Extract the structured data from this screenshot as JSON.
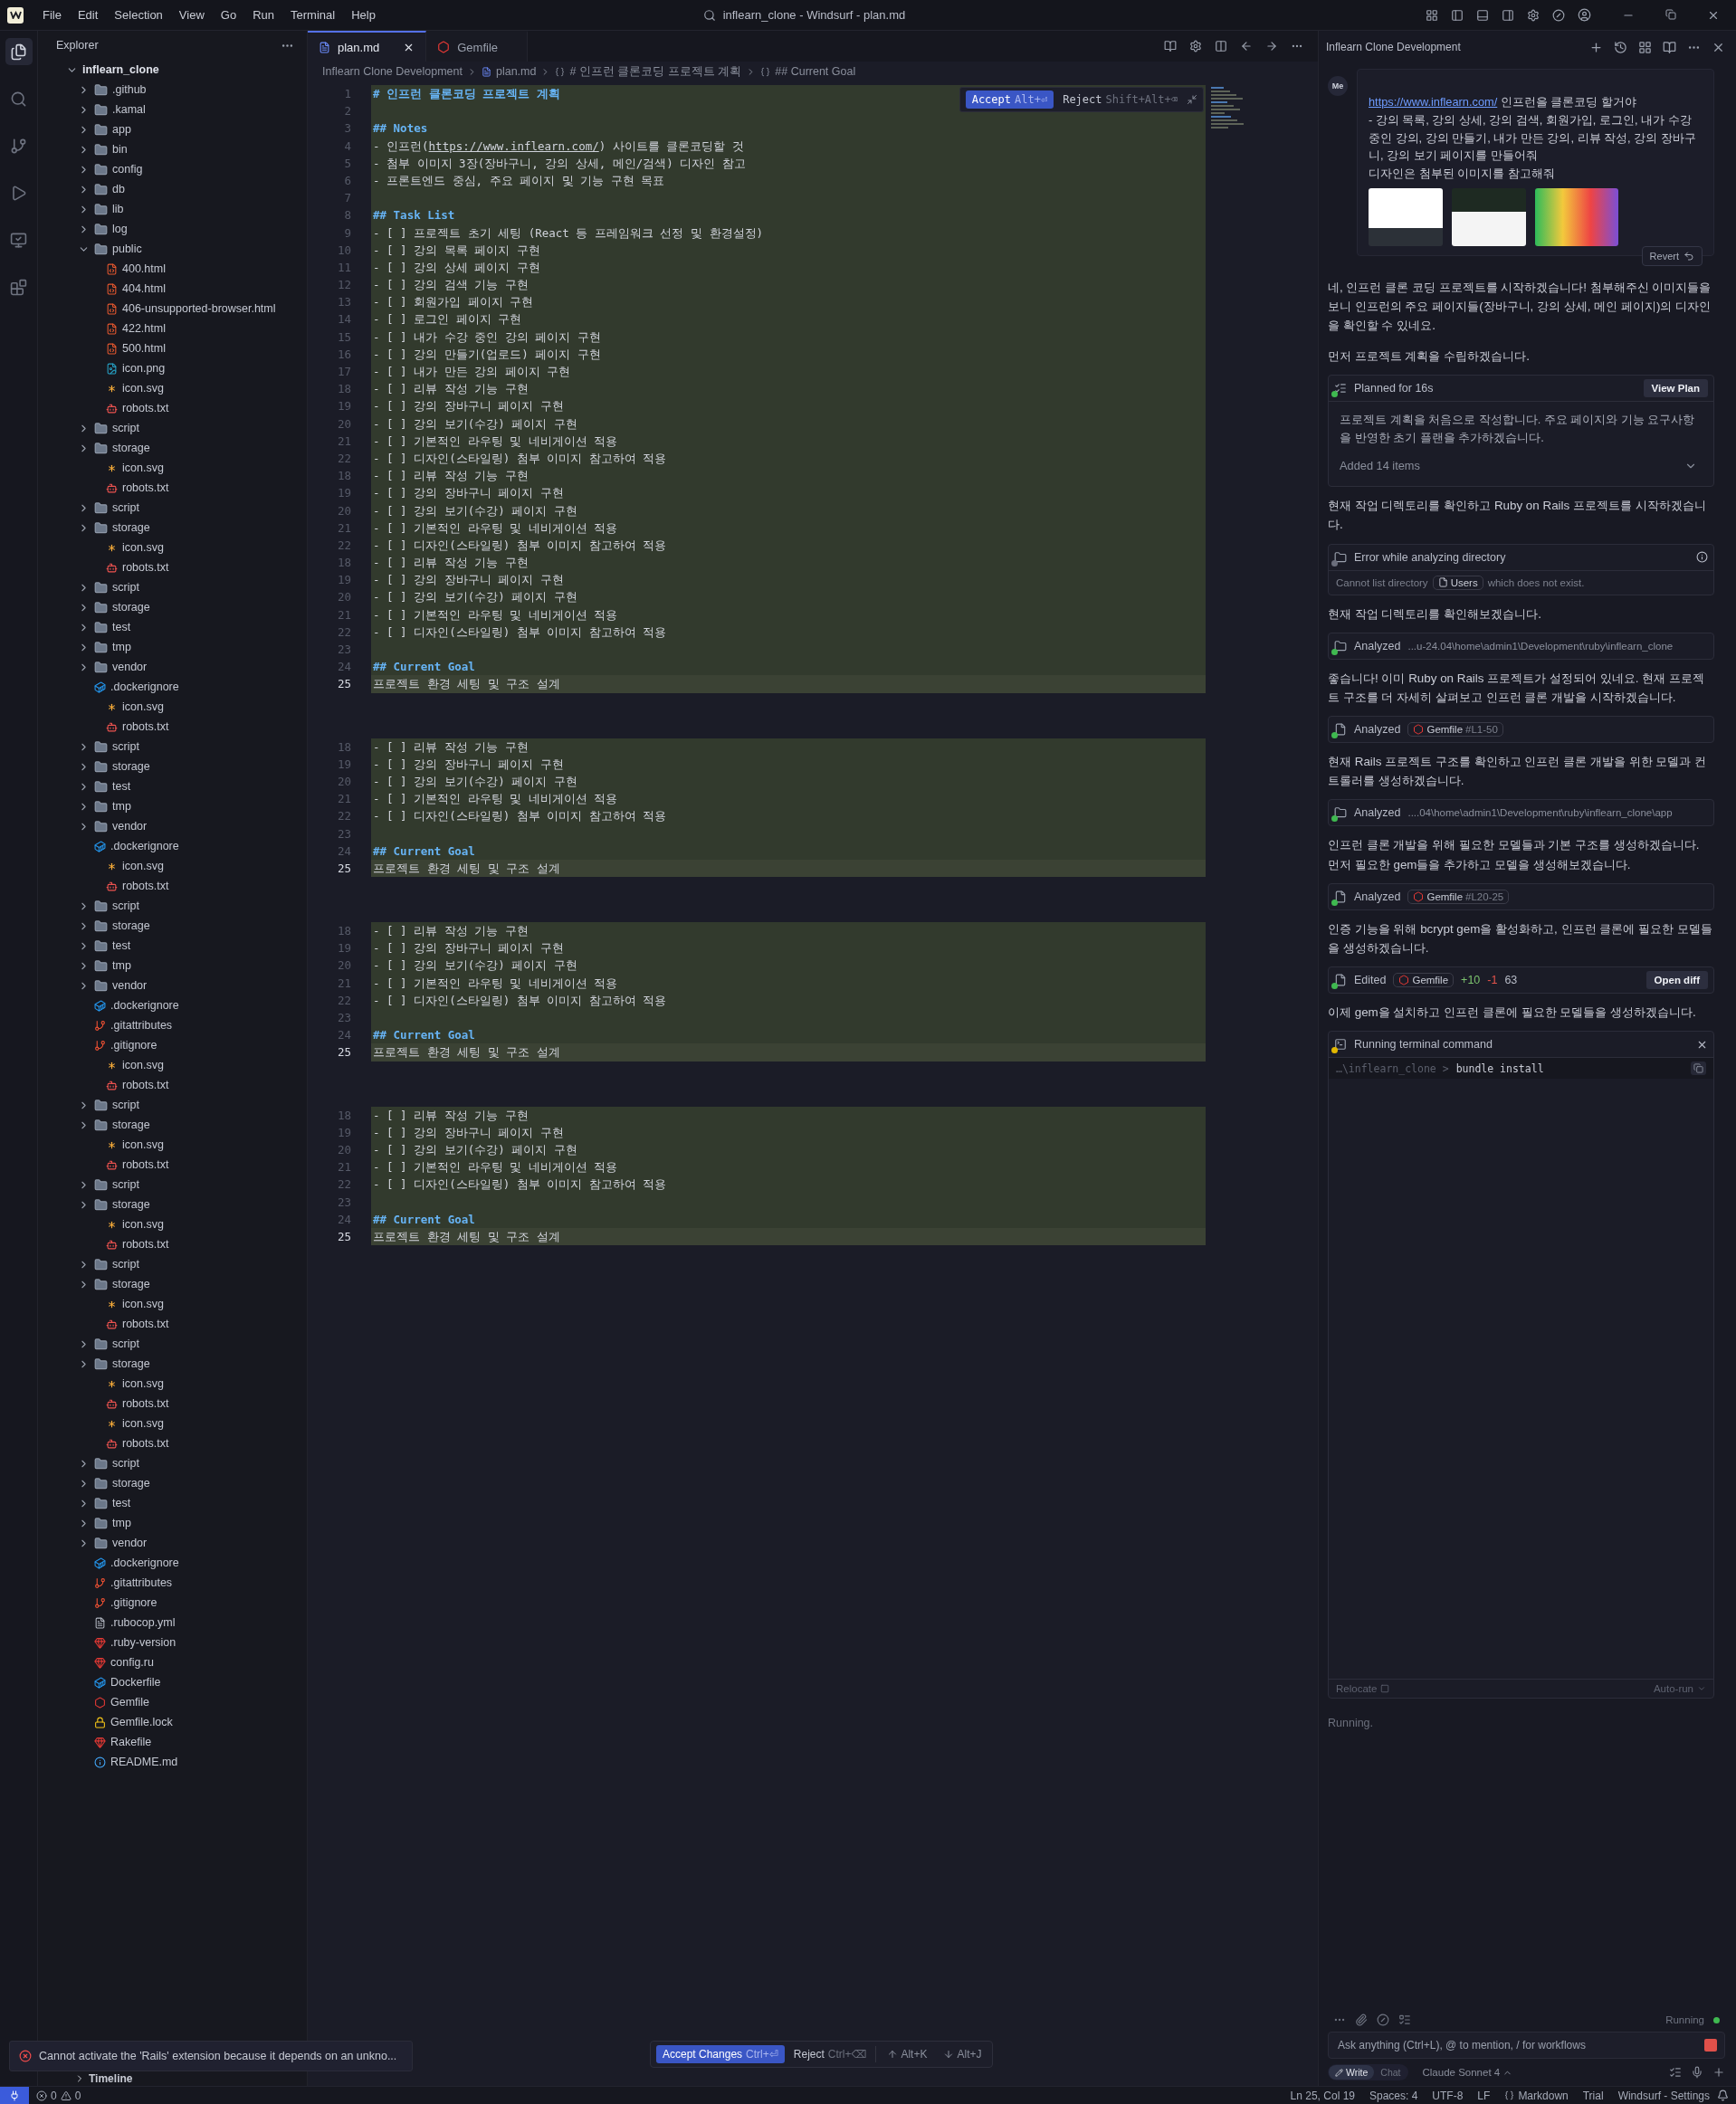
{
  "titlebar": {
    "menu": [
      "File",
      "Edit",
      "Selection",
      "View",
      "Go",
      "Run",
      "Terminal",
      "Help"
    ],
    "title": "inflearn_clone - Windsurf - plan.md"
  },
  "explorer": {
    "title": "Explorer",
    "timeline": "Timeline",
    "tree": {
      "name": "inflearn_clone",
      "kind": "folder",
      "expanded": true,
      "children": [
        {
          "name": ".github",
          "kind": "folder",
          "expanded": false
        },
        {
          "name": ".kamal",
          "kind": "folder",
          "expanded": false
        },
        {
          "name": "app",
          "kind": "folder",
          "expanded": false
        },
        {
          "name": "bin",
          "kind": "folder",
          "expanded": false
        },
        {
          "name": "config",
          "kind": "folder",
          "expanded": false
        },
        {
          "name": "db",
          "kind": "folder",
          "expanded": false
        },
        {
          "name": "lib",
          "kind": "folder",
          "expanded": false
        },
        {
          "name": "log",
          "kind": "folder",
          "expanded": false
        },
        {
          "name": "public",
          "kind": "folder",
          "expanded": true,
          "children": [
            {
              "name": "400.html",
              "kind": "html"
            },
            {
              "name": "404.html",
              "kind": "html"
            },
            {
              "name": "406-unsupported-browser.html",
              "kind": "html"
            },
            {
              "name": "422.html",
              "kind": "html"
            },
            {
              "name": "500.html",
              "kind": "html"
            },
            {
              "name": "icon.png",
              "kind": "image"
            },
            {
              "name": "icon.svg",
              "kind": "svg"
            },
            {
              "name": "robots.txt",
              "kind": "robots"
            }
          ]
        },
        {
          "name": "script",
          "kind": "folder",
          "expanded": false
        },
        {
          "name": "storage",
          "kind": "folder",
          "expanded": false,
          "children": [
            {
              "name": "icon.svg",
              "kind": "svg"
            },
            {
              "name": "robots.txt",
              "kind": "robots"
            }
          ]
        },
        {
          "name": "script",
          "kind": "folder",
          "expanded": false
        },
        {
          "name": "storage",
          "kind": "folder",
          "expanded": false,
          "children": [
            {
              "name": "icon.svg",
              "kind": "svg"
            },
            {
              "name": "robots.txt",
              "kind": "robots"
            }
          ]
        },
        {
          "name": "script",
          "kind": "folder",
          "expanded": false
        },
        {
          "name": "storage",
          "kind": "folder",
          "expanded": false
        },
        {
          "name": "test",
          "kind": "folder",
          "expanded": false
        },
        {
          "name": "tmp",
          "kind": "folder",
          "expanded": false
        },
        {
          "name": "vendor",
          "kind": "folder",
          "expanded": false
        },
        {
          "name": ".dockerignore",
          "kind": "docker",
          "children": [
            {
              "name": "icon.svg",
              "kind": "svg"
            },
            {
              "name": "robots.txt",
              "kind": "robots"
            }
          ]
        },
        {
          "name": "script",
          "kind": "folder",
          "expanded": false
        },
        {
          "name": "storage",
          "kind": "folder",
          "expanded": false
        },
        {
          "name": "test",
          "kind": "folder",
          "expanded": false
        },
        {
          "name": "tmp",
          "kind": "folder",
          "expanded": false
        },
        {
          "name": "vendor",
          "kind": "folder",
          "expanded": false
        },
        {
          "name": ".dockerignore",
          "kind": "docker",
          "children": [
            {
              "name": "icon.svg",
              "kind": "svg"
            },
            {
              "name": "robots.txt",
              "kind": "robots"
            }
          ]
        },
        {
          "name": "script",
          "kind": "folder",
          "expanded": false
        },
        {
          "name": "storage",
          "kind": "folder",
          "expanded": false
        },
        {
          "name": "test",
          "kind": "folder",
          "expanded": false
        },
        {
          "name": "tmp",
          "kind": "folder",
          "expanded": false
        },
        {
          "name": "vendor",
          "kind": "folder",
          "expanded": false
        },
        {
          "name": ".dockerignore",
          "kind": "docker"
        },
        {
          "name": ".gitattributes",
          "kind": "git"
        },
        {
          "name": ".gitignore",
          "kind": "git",
          "children": [
            {
              "name": "icon.svg",
              "kind": "svg"
            },
            {
              "name": "robots.txt",
              "kind": "robots"
            }
          ]
        },
        {
          "name": "script",
          "kind": "folder",
          "expanded": false
        },
        {
          "name": "storage",
          "kind": "folder",
          "expanded": false,
          "children": [
            {
              "name": "icon.svg",
              "kind": "svg"
            },
            {
              "name": "robots.txt",
              "kind": "robots"
            }
          ]
        },
        {
          "name": "script",
          "kind": "folder",
          "expanded": false
        },
        {
          "name": "storage",
          "kind": "folder",
          "expanded": false,
          "children": [
            {
              "name": "icon.svg",
              "kind": "svg"
            },
            {
              "name": "robots.txt",
              "kind": "robots"
            }
          ]
        },
        {
          "name": "script",
          "kind": "folder",
          "expanded": false
        },
        {
          "name": "storage",
          "kind": "folder",
          "expanded": false,
          "children": [
            {
              "name": "icon.svg",
              "kind": "svg"
            },
            {
              "name": "robots.txt",
              "kind": "robots"
            }
          ]
        },
        {
          "name": "script",
          "kind": "folder",
          "expanded": false
        },
        {
          "name": "storage",
          "kind": "folder",
          "expanded": false,
          "children": [
            {
              "name": "icon.svg",
              "kind": "svg"
            },
            {
              "name": "robots.txt",
              "kind": "robots"
            },
            {
              "name": "icon.svg",
              "kind": "svg"
            },
            {
              "name": "robots.txt",
              "kind": "robots"
            }
          ]
        },
        {
          "name": "script",
          "kind": "folder",
          "expanded": false
        },
        {
          "name": "storage",
          "kind": "folder",
          "expanded": false
        },
        {
          "name": "test",
          "kind": "folder",
          "expanded": false
        },
        {
          "name": "tmp",
          "kind": "folder",
          "expanded": false
        },
        {
          "name": "vendor",
          "kind": "folder",
          "expanded": false
        },
        {
          "name": ".dockerignore",
          "kind": "docker"
        },
        {
          "name": ".gitattributes",
          "kind": "git"
        },
        {
          "name": ".gitignore",
          "kind": "git"
        },
        {
          "name": ".rubocop.yml",
          "kind": "yaml"
        },
        {
          "name": ".ruby-version",
          "kind": "ruby"
        },
        {
          "name": "config.ru",
          "kind": "ruby"
        },
        {
          "name": "Dockerfile",
          "kind": "docker"
        },
        {
          "name": "Gemfile",
          "kind": "gem"
        },
        {
          "name": "Gemfile.lock",
          "kind": "lock"
        },
        {
          "name": "Rakefile",
          "kind": "ruby"
        },
        {
          "name": "README.md",
          "kind": "info"
        }
      ]
    }
  },
  "tabs": [
    {
      "label": "plan.md",
      "kind": "markdown",
      "selected": true
    },
    {
      "label": "Gemfile",
      "kind": "gem",
      "selected": false
    }
  ],
  "breadcrumb": [
    "Inflearn Clone Development",
    "plan.md",
    "# 인프런 클론코딩 프로젝트 계획",
    "## Current Goal"
  ],
  "diff_toolbar": {
    "accept": "Accept",
    "accept_key": "Alt+⏎",
    "reject": "Reject",
    "reject_key": "Shift+Alt+⌫"
  },
  "editor": {
    "blocks": [
      {
        "lines": [
          {
            "number": "1",
            "kind": "h1",
            "text": "# 인프런 클론코딩 프로젝트 계획",
            "current": false
          },
          {
            "number": "2",
            "kind": "blank",
            "current": false
          },
          {
            "number": "3",
            "kind": "h2",
            "text": "## Notes",
            "current": false
          },
          {
            "number": "4",
            "kind": "link",
            "before": "- 인프런(",
            "link": "https://www.inflearn.com/",
            "after": ") 사이트를 클론코딩할 것",
            "current": false
          },
          {
            "number": "5",
            "kind": "text",
            "text": "- 첨부 이미지 3장(장바구니, 강의 상세, 메인/검색) 디자인 참고",
            "current": false
          },
          {
            "number": "6",
            "kind": "text",
            "text": "- 프론트엔드 중심, 주요 페이지 및 기능 구현 목표",
            "current": false
          },
          {
            "number": "7",
            "kind": "blank",
            "current": false
          },
          {
            "number": "8",
            "kind": "h2",
            "text": "## Task List",
            "current": false
          },
          {
            "number": "9",
            "kind": "text",
            "text": "- [ ] 프로젝트 초기 세팅 (React 등 프레임워크 선정 및 환경설정)",
            "current": false
          },
          {
            "number": "10",
            "kind": "text",
            "text": "- [ ] 강의 목록 페이지 구현",
            "current": false
          },
          {
            "number": "11",
            "kind": "text",
            "text": "- [ ] 강의 상세 페이지 구현",
            "current": false
          },
          {
            "number": "12",
            "kind": "text",
            "text": "- [ ] 강의 검색 기능 구현",
            "current": false
          },
          {
            "number": "13",
            "kind": "text",
            "text": "- [ ] 회원가입 페이지 구현",
            "current": false
          },
          {
            "number": "14",
            "kind": "text",
            "text": "- [ ] 로그인 페이지 구현",
            "current": false
          },
          {
            "number": "15",
            "kind": "text",
            "text": "- [ ] 내가 수강 중인 강의 페이지 구현",
            "current": false
          },
          {
            "number": "16",
            "kind": "text",
            "text": "- [ ] 강의 만들기(업로드) 페이지 구현",
            "current": false
          },
          {
            "number": "17",
            "kind": "text",
            "text": "- [ ] 내가 만든 강의 페이지 구현",
            "current": false
          },
          {
            "number": "18",
            "kind": "text",
            "text": "- [ ] 리뷰 작성 기능 구현",
            "current": false
          },
          {
            "number": "19",
            "kind": "text",
            "text": "- [ ] 강의 장바구니 페이지 구현",
            "current": false
          },
          {
            "number": "20",
            "kind": "text",
            "text": "- [ ] 강의 보기(수강) 페이지 구현",
            "current": false
          },
          {
            "number": "21",
            "kind": "text",
            "text": "- [ ] 기본적인 라우팅 및 네비게이션 적용",
            "current": false
          },
          {
            "number": "22",
            "kind": "text",
            "text": "- [ ] 디자인(스타일링) 첨부 이미지 참고하여 적용",
            "current": false
          },
          {
            "number": "18",
            "kind": "text",
            "text": "- [ ] 리뷰 작성 기능 구현",
            "current": false
          },
          {
            "number": "19",
            "kind": "text",
            "text": "- [ ] 강의 장바구니 페이지 구현",
            "current": false
          },
          {
            "number": "20",
            "kind": "text",
            "text": "- [ ] 강의 보기(수강) 페이지 구현",
            "current": false
          },
          {
            "number": "21",
            "kind": "text",
            "text": "- [ ] 기본적인 라우팅 및 네비게이션 적용",
            "current": false
          },
          {
            "number": "22",
            "kind": "text",
            "text": "- [ ] 디자인(스타일링) 첨부 이미지 참고하여 적용",
            "current": false
          },
          {
            "number": "18",
            "kind": "text",
            "text": "- [ ] 리뷰 작성 기능 구현",
            "current": false
          },
          {
            "number": "19",
            "kind": "text",
            "text": "- [ ] 강의 장바구니 페이지 구현",
            "current": false
          },
          {
            "number": "20",
            "kind": "text",
            "text": "- [ ] 강의 보기(수강) 페이지 구현",
            "current": false
          },
          {
            "number": "21",
            "kind": "text",
            "text": "- [ ] 기본적인 라우팅 및 네비게이션 적용",
            "current": false
          },
          {
            "number": "22",
            "kind": "text",
            "text": "- [ ] 디자인(스타일링) 첨부 이미지 참고하여 적용",
            "current": false
          },
          {
            "number": "23",
            "kind": "blank",
            "current": false
          },
          {
            "number": "24",
            "kind": "h2",
            "text": "## Current Goal",
            "current": false
          },
          {
            "number": "25",
            "kind": "text",
            "text": "프로젝트 환경 세팅 및 구조 설계",
            "current": true
          }
        ]
      },
      {
        "lines": [
          {
            "number": "18",
            "kind": "text",
            "text": "- [ ] 리뷰 작성 기능 구현",
            "current": false
          },
          {
            "number": "19",
            "kind": "text",
            "text": "- [ ] 강의 장바구니 페이지 구현",
            "current": false
          },
          {
            "number": "20",
            "kind": "text",
            "text": "- [ ] 강의 보기(수강) 페이지 구현",
            "current": false
          },
          {
            "number": "21",
            "kind": "text",
            "text": "- [ ] 기본적인 라우팅 및 네비게이션 적용",
            "current": false
          },
          {
            "number": "22",
            "kind": "text",
            "text": "- [ ] 디자인(스타일링) 첨부 이미지 참고하여 적용",
            "current": false
          },
          {
            "number": "23",
            "kind": "blank",
            "current": false
          },
          {
            "number": "24",
            "kind": "h2",
            "text": "## Current Goal",
            "current": false
          },
          {
            "number": "25",
            "kind": "text",
            "text": "프로젝트 환경 세팅 및 구조 설계",
            "current": true
          }
        ]
      },
      {
        "lines": [
          {
            "number": "18",
            "kind": "text",
            "text": "- [ ] 리뷰 작성 기능 구현",
            "current": false
          },
          {
            "number": "19",
            "kind": "text",
            "text": "- [ ] 강의 장바구니 페이지 구현",
            "current": false
          },
          {
            "number": "20",
            "kind": "text",
            "text": "- [ ] 강의 보기(수강) 페이지 구현",
            "current": false
          },
          {
            "number": "21",
            "kind": "text",
            "text": "- [ ] 기본적인 라우팅 및 네비게이션 적용",
            "current": false
          },
          {
            "number": "22",
            "kind": "text",
            "text": "- [ ] 디자인(스타일링) 첨부 이미지 참고하여 적용",
            "current": false
          },
          {
            "number": "23",
            "kind": "blank",
            "current": false
          },
          {
            "number": "24",
            "kind": "h2",
            "text": "## Current Goal",
            "current": false
          },
          {
            "number": "25",
            "kind": "text",
            "text": "프로젝트 환경 세팅 및 구조 설계",
            "current": true
          }
        ]
      },
      {
        "lines": [
          {
            "number": "18",
            "kind": "text",
            "text": "- [ ] 리뷰 작성 기능 구현",
            "current": false
          },
          {
            "number": "19",
            "kind": "text",
            "text": "- [ ] 강의 장바구니 페이지 구현",
            "current": false
          },
          {
            "number": "20",
            "kind": "text",
            "text": "- [ ] 강의 보기(수강) 페이지 구현",
            "current": false
          },
          {
            "number": "21",
            "kind": "text",
            "text": "- [ ] 기본적인 라우팅 및 네비게이션 적용",
            "current": false
          },
          {
            "number": "22",
            "kind": "text",
            "text": "- [ ] 디자인(스타일링) 첨부 이미지 참고하여 적용",
            "current": false
          },
          {
            "number": "23",
            "kind": "blank",
            "current": false
          },
          {
            "number": "24",
            "kind": "h2",
            "text": "## Current Goal",
            "current": false
          },
          {
            "number": "25",
            "kind": "text",
            "text": "프로젝트 환경 세팅 및 구조 설계",
            "current": true
          }
        ]
      }
    ]
  },
  "review_bar": {
    "accept": "Accept Changes",
    "accept_key": "Ctrl+⏎",
    "reject": "Reject",
    "reject_key": "Ctrl+⌫",
    "prev_key": "Alt+K",
    "next_key": "Alt+J"
  },
  "notification": {
    "text": "Cannot activate the 'Rails' extension because it depends on an unkno..."
  },
  "chat": {
    "title": "Inflearn Clone Development",
    "messages": [
      {
        "kind": "user",
        "avatar": "Me",
        "link": "https://www.inflearn.com/",
        "after": " 인프런을 클론코딩 할거야",
        "paragraphs": [
          "- 강의 목록, 강의 상세, 강의 검색, 회원가입, 로그인, 내가 수강 중인 강의, 강의 만들기, 내가 만든 강의, 리뷰 작성, 강의 장바구니, 강의 보기 페이지를 만들어줘",
          "디자인은  첨부된 이미지를 참고해줘"
        ],
        "attachments": [
          {
            "kind": "light"
          },
          {
            "kind": "dark"
          },
          {
            "kind": "colorful"
          }
        ],
        "revert": "Revert"
      },
      {
        "kind": "text",
        "text": "네, 인프런 클론 코딩 프로젝트를 시작하겠습니다! 첨부해주신 이미지들을 보니 인프런의 주요 페이지들(장바구니, 강의 상세, 메인 페이지)의 디자인을 확인할 수 있네요."
      },
      {
        "kind": "text",
        "text": "먼저 프로젝트 계획을 수립하겠습니다."
      },
      {
        "kind": "plan",
        "color": "#3fb950",
        "title": "Planned for 16s",
        "button": "View Plan",
        "body": "프로젝트 계획을 처음으로 작성합니다. 주요 페이지와 기능 요구사항을 반영한 초기 플랜을 추가하겠습니다.",
        "footer": "Added 14 items"
      },
      {
        "kind": "text",
        "text": "현재 작업 디렉토리를 확인하고 Ruby on Rails 프로젝트를 시작하겠습니다."
      },
      {
        "kind": "error",
        "color": "#6b6e7c",
        "title": "Error while analyzing directory",
        "before": "Cannot list directory",
        "chip": "Users",
        "after": "which does not exist."
      },
      {
        "kind": "text",
        "text": "현재 작업 디렉토리를 확인해보겠습니다."
      },
      {
        "kind": "analyzed",
        "color": "#3fb950",
        "label": "Analyzed",
        "path": "...u-24.04\\home\\admin1\\Development\\ruby\\inflearn_clone"
      },
      {
        "kind": "text",
        "text": "좋습니다! 이미 Ruby on Rails 프로젝트가 설정되어 있네요. 현재 프로젝트 구조를 더 자세히 살펴보고 인프런 클론 개발을 시작하겠습니다."
      },
      {
        "kind": "file",
        "color": "#3fb950",
        "label": "Analyzed",
        "file": "Gemfile",
        "range": "#L1-50"
      },
      {
        "kind": "text",
        "text": "현재 Rails 프로젝트 구조를 확인하고 인프런 클론 개발을 위한 모델과 컨트롤러를 생성하겠습니다."
      },
      {
        "kind": "analyzed",
        "color": "#3fb950",
        "label": "Analyzed",
        "path": "....04\\home\\admin1\\Development\\ruby\\inflearn_clone\\app"
      },
      {
        "kind": "text",
        "text": "인프런 클론 개발을 위해 필요한 모델들과 기본 구조를 생성하겠습니다. 먼저 필요한 gem들을 추가하고 모델을 생성해보겠습니다."
      },
      {
        "kind": "file",
        "color": "#3fb950",
        "label": "Analyzed",
        "file": "Gemfile",
        "range": "#L20-25"
      },
      {
        "kind": "text",
        "text": "인증 기능을 위해 bcrypt gem을 활성화하고, 인프런 클론에 필요한 모델들을 생성하겠습니다."
      },
      {
        "kind": "edited",
        "color": "#3fb950",
        "label": "Edited",
        "file": "Gemfile",
        "added": "+10",
        "removed": "-1",
        "count": "63",
        "button": "Open diff"
      },
      {
        "kind": "text",
        "text": "이제 gem을 설치하고 인프런 클론에 필요한 모델들을 생성하겠습니다."
      },
      {
        "kind": "terminal",
        "color": "#e3b800",
        "title": "Running terminal command",
        "prefix": "…\\inflearn_clone >",
        "command": "bundle install",
        "relocate": "Relocate",
        "autorun": "Auto-run"
      },
      {
        "kind": "status",
        "text": "Running."
      }
    ],
    "composer": {
      "status": "Running",
      "placeholder": "Ask anything (Ctrl+L), @ to mention, / for workflows",
      "modes": [
        {
          "label": "Write",
          "selected": true
        },
        {
          "label": "Chat",
          "selected": false
        }
      ],
      "model": "Claude Sonnet 4"
    }
  },
  "status_bar": {
    "errors": "0",
    "warnings": "0",
    "items": [
      "Ln 25, Col 19",
      "Spaces: 4",
      "UTF-8",
      "LF",
      "Markdown",
      "Trial",
      "Windsurf - Settings"
    ]
  }
}
